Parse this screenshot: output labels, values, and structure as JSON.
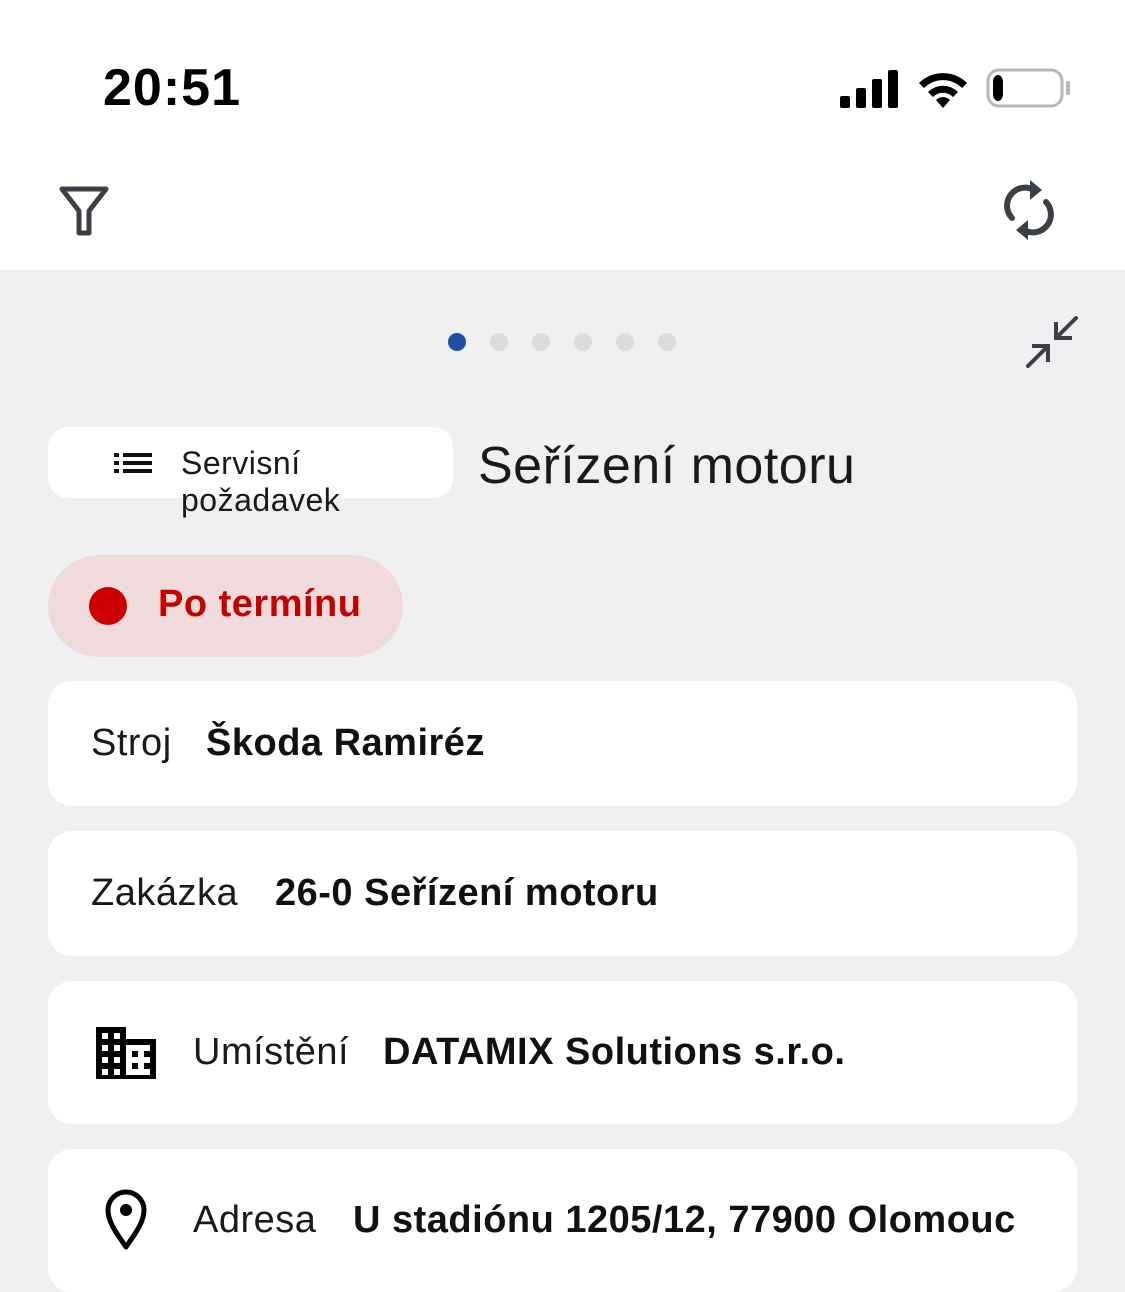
{
  "status_bar": {
    "time": "20:51",
    "signal_icon": "cellular-signal-icon",
    "wifi_icon": "wifi-icon",
    "battery_icon": "battery-icon",
    "battery_level": 0.15
  },
  "toolbar": {
    "filter_icon": "filter-icon",
    "refresh_icon": "refresh-icon"
  },
  "pager": {
    "total_pages": 6,
    "current_page": 1,
    "active_color": "#1d4fa3",
    "collapse_icon": "collapse-icon"
  },
  "header": {
    "type_chip_icon": "list-icon",
    "type_chip_label": "Servisní požadavek",
    "title": "Seřízení motoru"
  },
  "status": {
    "label": "Po termínu",
    "color": "#cc0000"
  },
  "details": {
    "machine": {
      "label": "Stroj",
      "value": "Škoda Ramiréz"
    },
    "order": {
      "label": "Zakázka",
      "value": "26-0 Seřízení motoru"
    },
    "location": {
      "icon": "building-icon",
      "label": "Umístění",
      "value": "DATAMIX Solutions s.r.o."
    },
    "address": {
      "icon": "location-pin-icon",
      "label": "Adresa",
      "value": "U stadiónu 1205/12, 77900 Olomouc"
    }
  }
}
